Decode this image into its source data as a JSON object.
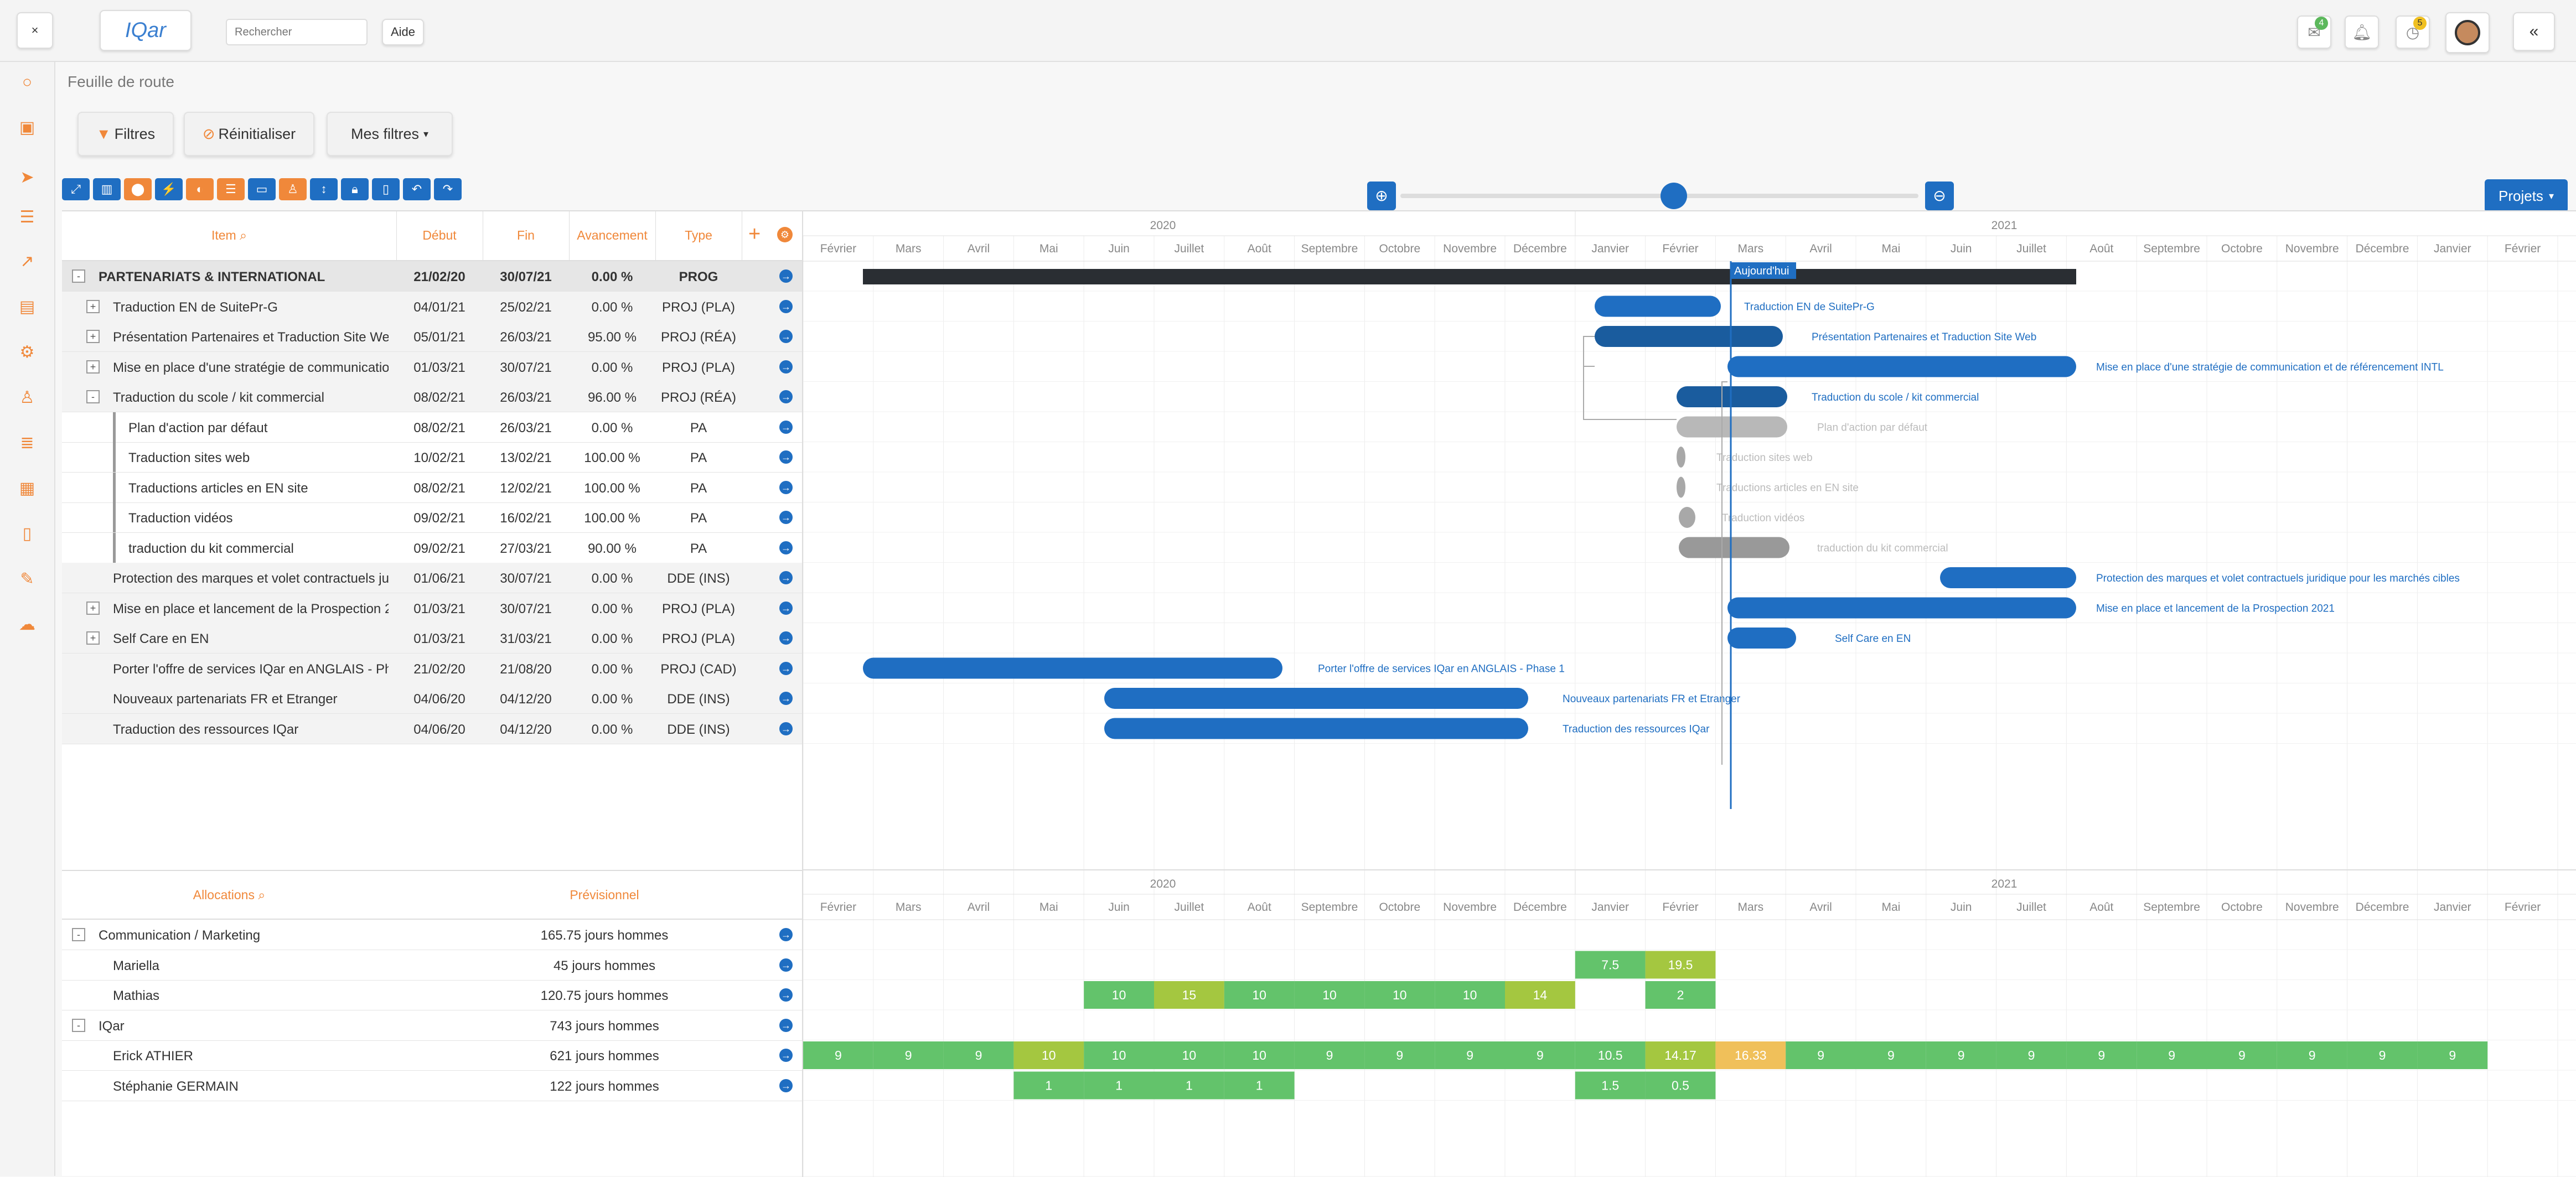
{
  "topbar": {
    "close": "×",
    "logo": "IQar",
    "search_placeholder": "Rechercher",
    "help": "Aide",
    "collapse": "«",
    "badge_mail": "4",
    "badge_clock": "5"
  },
  "breadcrumb": "Feuille de route",
  "filters": {
    "filtres": "Filtres",
    "reinit": "Réinitialiser",
    "mes_filtres": "Mes filtres"
  },
  "projets": "Projets",
  "columns": {
    "item": "Item",
    "debut": "Début",
    "fin": "Fin",
    "avancement": "Avancement",
    "type": "Type"
  },
  "years": [
    "2020",
    "2021"
  ],
  "months": [
    "Février",
    "Mars",
    "Avril",
    "Mai",
    "Juin",
    "Juillet",
    "Août",
    "Septembre",
    "Octobre",
    "Novembre",
    "Décembre",
    "Janvier",
    "Février",
    "Mars",
    "Avril",
    "Mai",
    "Juin",
    "Juillet",
    "Août",
    "Septembre",
    "Octobre",
    "Novembre",
    "Décembre",
    "Janvier",
    "Février"
  ],
  "today_label": "Aujourd'hui",
  "tasks": [
    {
      "name": "PARTENARIATS & INTERNATIONAL",
      "start": "21/02/20",
      "end": "30/07/21",
      "progress": "0.00 %",
      "type": "PROG"
    },
    {
      "name": "Traduction EN de SuitePr-G",
      "start": "04/01/21",
      "end": "25/02/21",
      "progress": "0.00 %",
      "type": "PROJ (PLA)"
    },
    {
      "name": "Présentation Partenaires et Traduction Site Web",
      "start": "05/01/21",
      "end": "26/03/21",
      "progress": "95.00 %",
      "type": "PROJ (RÉA)"
    },
    {
      "name": "Mise en place d'une stratégie de communication",
      "start": "01/03/21",
      "end": "30/07/21",
      "progress": "0.00 %",
      "type": "PROJ (PLA)"
    },
    {
      "name": "Traduction du scole / kit commercial",
      "start": "08/02/21",
      "end": "26/03/21",
      "progress": "96.00 %",
      "type": "PROJ (RÉA)"
    },
    {
      "name": "Plan d'action par défaut",
      "start": "08/02/21",
      "end": "26/03/21",
      "progress": "0.00 %",
      "type": "PA"
    },
    {
      "name": "Traduction sites web",
      "start": "10/02/21",
      "end": "13/02/21",
      "progress": "100.00 %",
      "type": "PA"
    },
    {
      "name": "Traductions articles en EN site",
      "start": "08/02/21",
      "end": "12/02/21",
      "progress": "100.00 %",
      "type": "PA"
    },
    {
      "name": "Traduction vidéos",
      "start": "09/02/21",
      "end": "16/02/21",
      "progress": "100.00 %",
      "type": "PA"
    },
    {
      "name": "traduction du kit commercial",
      "start": "09/02/21",
      "end": "27/03/21",
      "progress": "90.00 %",
      "type": "PA"
    },
    {
      "name": "Protection des marques et volet contractuels juric",
      "start": "01/06/21",
      "end": "30/07/21",
      "progress": "0.00 %",
      "type": "DDE (INS)"
    },
    {
      "name": "Mise en place et lancement de la Prospection 20:",
      "start": "01/03/21",
      "end": "30/07/21",
      "progress": "0.00 %",
      "type": "PROJ (PLA)"
    },
    {
      "name": "Self Care en EN",
      "start": "01/03/21",
      "end": "31/03/21",
      "progress": "0.00 %",
      "type": "PROJ (PLA)"
    },
    {
      "name": "Porter l'offre de services IQar en ANGLAIS - Pha",
      "start": "21/02/20",
      "end": "21/08/20",
      "progress": "0.00 %",
      "type": "PROJ (CAD)"
    },
    {
      "name": "Nouveaux partenariats FR et Etranger",
      "start": "04/06/20",
      "end": "04/12/20",
      "progress": "0.00 %",
      "type": "DDE (INS)"
    },
    {
      "name": "Traduction des ressources IQar",
      "start": "04/06/20",
      "end": "04/12/20",
      "progress": "0.00 %",
      "type": "DDE (INS)"
    }
  ],
  "bar_labels": [
    "Traduction EN de SuitePr-G",
    "Présentation Partenaires et Traduction Site Web",
    "Mise en place d'une stratégie de communication et de référencement INTL",
    "Traduction du scole / kit commercial",
    "Plan d'action par défaut",
    "Traduction sites web",
    "Traductions articles en EN site",
    "Traduction vidéos",
    "traduction du kit commercial",
    "Protection des marques et volet contractuels juridique pour les marchés cibles",
    "Mise en place et lancement de la Prospection 2021",
    "Self Care en EN",
    "Porter l'offre de services IQar en ANGLAIS - Phase 1",
    "Nouveaux partenariats FR et Etranger",
    "Traduction des ressources IQar"
  ],
  "alloc_header": {
    "allocations": "Allocations",
    "prev": "Prévisionnel"
  },
  "alloc": [
    {
      "name": "Communication / Marketing",
      "val": "165.75 jours hommes"
    },
    {
      "name": "Mariella",
      "val": "45 jours hommes"
    },
    {
      "name": "Mathias",
      "val": "120.75 jours hommes"
    },
    {
      "name": "IQar",
      "val": "743 jours hommes"
    },
    {
      "name": "Erick ATHIER",
      "val": "621 jours hommes"
    },
    {
      "name": "Stéphanie GERMAIN",
      "val": "122 jours hommes"
    }
  ],
  "alloc_values": {
    "mariella": [
      "7.5",
      "19.5"
    ],
    "mathias": [
      "10",
      "15",
      "10",
      "10",
      "10",
      "10",
      "14",
      "2"
    ],
    "erick": [
      "9",
      "9",
      "9",
      "10",
      "10",
      "10",
      "10",
      "9",
      "9",
      "9",
      "9",
      "10.5",
      "14.17",
      "16.33",
      "9",
      "9",
      "9",
      "9",
      "9",
      "9",
      "9",
      "9",
      "9",
      "9"
    ],
    "stephanie": [
      "1",
      "1",
      "1",
      "1",
      "1.5",
      "0.5"
    ]
  }
}
